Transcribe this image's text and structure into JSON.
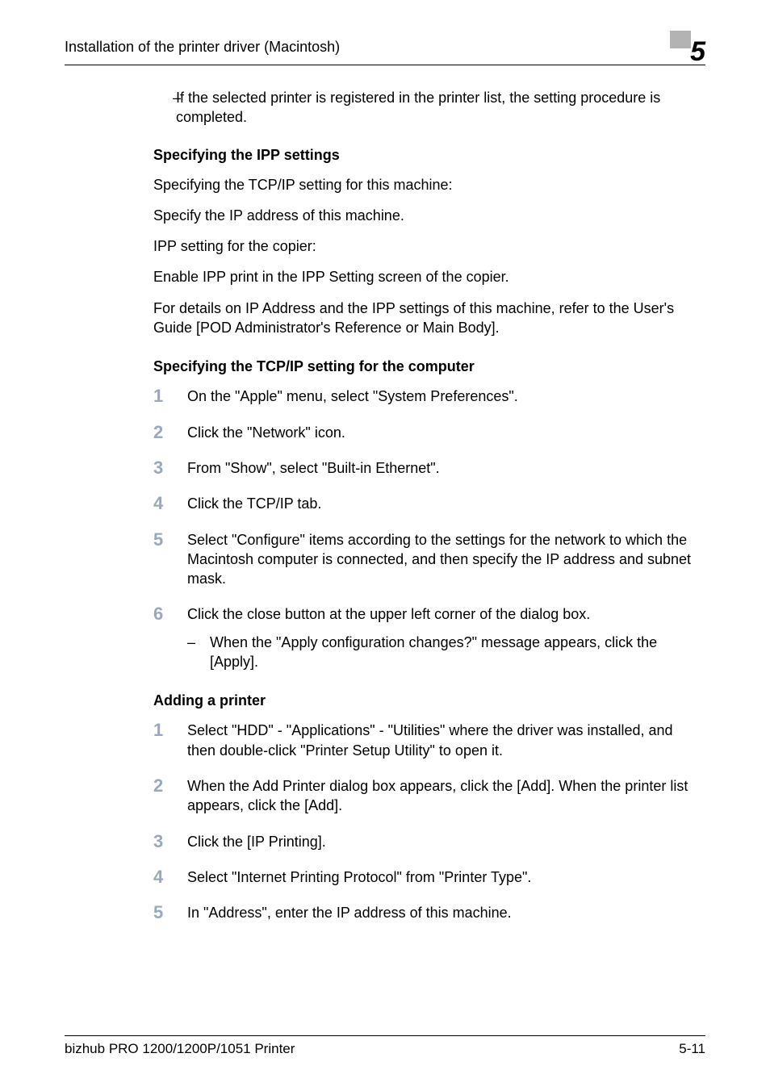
{
  "header": {
    "title": "Installation of the printer driver (Macintosh)",
    "chapter": "5"
  },
  "top_bullet": {
    "dash": "–",
    "text": "If the selected printer is registered in the printer list, the setting procedure is completed."
  },
  "section1": {
    "heading": "Specifying the IPP settings",
    "p1": "Specifying the TCP/IP setting for this machine:",
    "p2": "Specify the IP address of this machine.",
    "p3": "IPP setting for the copier:",
    "p4": "Enable IPP print in the IPP Setting screen of the copier.",
    "p5": "For details on IP Address and the IPP settings of this machine, refer to the User's Guide [POD Administrator's Reference or Main Body]."
  },
  "section2": {
    "heading": "Specifying the TCP/IP setting for the computer",
    "steps": {
      "n1": "1",
      "t1": "On the \"Apple\" menu, select \"System Preferences\".",
      "n2": "2",
      "t2": "Click the \"Network\" icon.",
      "n3": "3",
      "t3": "From \"Show\", select \"Built-in Ethernet\".",
      "n4": "4",
      "t4": "Click the TCP/IP tab.",
      "n5": "5",
      "t5": "Select \"Configure\" items according to the settings for the network to which the Macintosh computer is connected, and then specify the IP address and subnet mask.",
      "n6": "6",
      "t6": "Click the close button at the upper left corner of the dialog box.",
      "sub_dash": "–",
      "sub_text": "When the \"Apply configuration changes?\" message appears, click the [Apply]."
    }
  },
  "section3": {
    "heading": "Adding a printer",
    "steps": {
      "n1": "1",
      "t1": "Select \"HDD\" - \"Applications\" - \"Utilities\" where the driver was installed, and then double-click \"Printer Setup Utility\" to open it.",
      "n2": "2",
      "t2": "When the Add Printer dialog box appears, click the [Add]. When the printer list appears, click the [Add].",
      "n3": "3",
      "t3": "Click the [IP Printing].",
      "n4": "4",
      "t4": "Select \"Internet Printing Protocol\" from \"Printer Type\".",
      "n5": "5",
      "t5": "In \"Address\", enter the IP address of this machine."
    }
  },
  "footer": {
    "left": "bizhub PRO 1200/1200P/1051 Printer",
    "right": "5-11"
  }
}
